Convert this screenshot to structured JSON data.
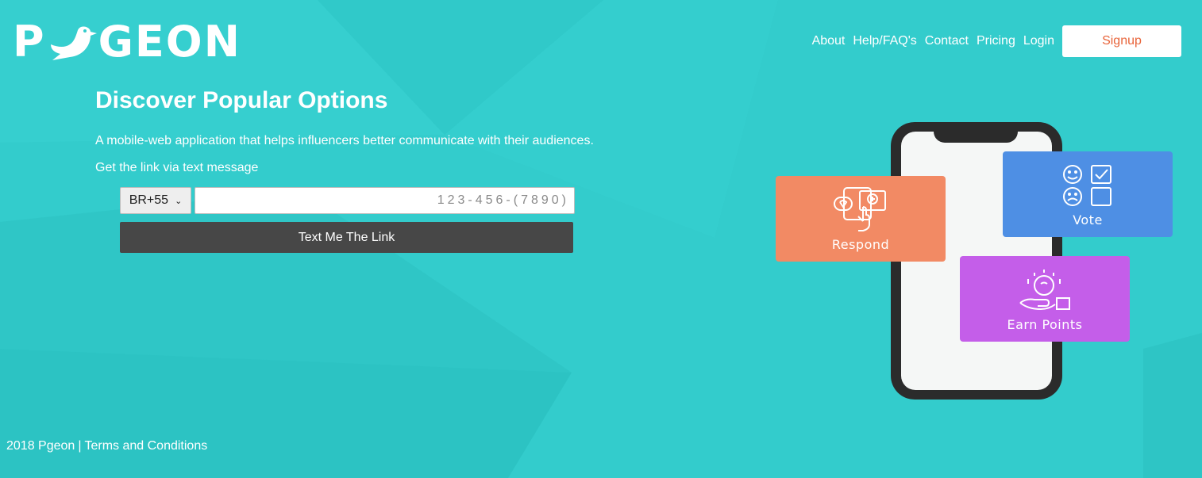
{
  "brand": {
    "logo_text": "PGEON",
    "logo_prefix": "P",
    "logo_suffix": "GEON",
    "background_color": "#33cccc",
    "accent_color": "#e8643a"
  },
  "nav": {
    "links": [
      {
        "label": "About"
      },
      {
        "label": "Help/FAQ's"
      },
      {
        "label": "Contact"
      },
      {
        "label": "Pricing"
      },
      {
        "label": "Login"
      }
    ],
    "signup_label": "Signup"
  },
  "hero": {
    "title": "Discover Popular Options",
    "description": "A mobile-web application that helps influencers better communicate with their audiences.",
    "subtitle": "Get the link via text message"
  },
  "form": {
    "country_selected": "BR+55",
    "phone_placeholder": "123-456-(7890)",
    "phone_value": "",
    "submit_label": "Text Me The Link"
  },
  "illustration": {
    "cards": [
      {
        "label": "Respond",
        "color": "#f28a64",
        "icon": "hand-touch-icon"
      },
      {
        "label": "Vote",
        "color": "#4e8fe4",
        "icon": "vote-faces-icon"
      },
      {
        "label": "Earn Points",
        "color": "#c45ee9",
        "icon": "coin-hand-icon"
      }
    ]
  },
  "footer": {
    "copyright": "2018 Pgeon",
    "separator": "|",
    "terms_label": "Terms and Conditions"
  }
}
